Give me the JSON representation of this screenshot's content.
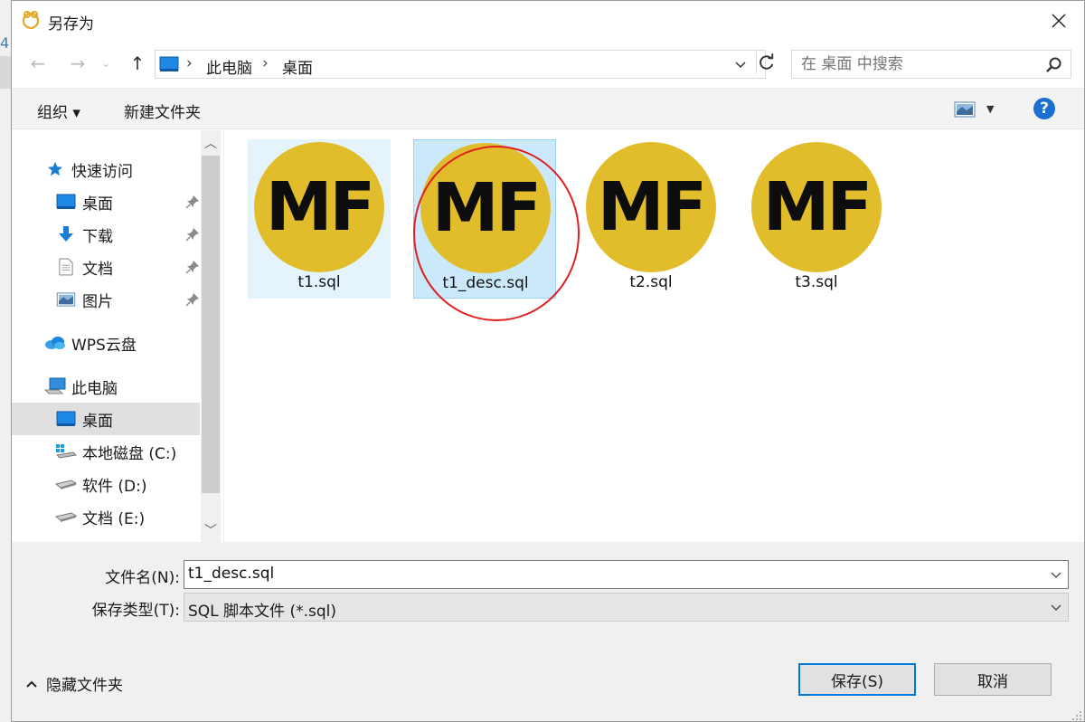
{
  "background": {
    "edge_number": "4"
  },
  "window": {
    "title": "另存为",
    "icon": "app-bee-icon"
  },
  "address": {
    "crumbs": [
      "此电脑",
      "桌面"
    ],
    "search_placeholder": "在 桌面 中搜索"
  },
  "toolbar": {
    "organize": "组织 ▾",
    "new_folder": "新建文件夹",
    "help": "?"
  },
  "sidebar": {
    "items": [
      {
        "label": "快速访问",
        "icon": "star-icon",
        "pinned": false
      },
      {
        "label": "桌面",
        "icon": "desktop-icon",
        "pinned": true
      },
      {
        "label": "下载",
        "icon": "download-icon",
        "pinned": true
      },
      {
        "label": "文档",
        "icon": "document-icon",
        "pinned": true
      },
      {
        "label": "图片",
        "icon": "pictures-icon",
        "pinned": true
      },
      {
        "label": "WPS云盘",
        "icon": "cloud-icon",
        "pinned": false
      },
      {
        "label": "此电脑",
        "icon": "computer-icon",
        "pinned": false
      },
      {
        "label": "桌面",
        "icon": "desktop-icon",
        "pinned": false,
        "selected": true
      },
      {
        "label": "本地磁盘 (C:)",
        "icon": "windows-drive-icon",
        "pinned": false
      },
      {
        "label": "软件 (D:)",
        "icon": "drive-icon",
        "pinned": false
      },
      {
        "label": "文档 (E:)",
        "icon": "drive-icon",
        "pinned": false
      }
    ]
  },
  "files": [
    {
      "name": "t1.sql",
      "logo_text": "MF",
      "state": "hover"
    },
    {
      "name": "t1_desc.sql",
      "logo_text": "MF",
      "state": "selected"
    },
    {
      "name": "t2.sql",
      "logo_text": "MF",
      "state": "normal"
    },
    {
      "name": "t3.sql",
      "logo_text": "MF",
      "state": "normal"
    }
  ],
  "form": {
    "filename_label": "文件名(N):",
    "filename_value": "t1_desc.sql",
    "type_label": "保存类型(T):",
    "type_value": "SQL 脚本文件 (*.sql)"
  },
  "footer": {
    "hide_folders": "隐藏文件夹",
    "save": "保存(S)",
    "cancel": "取消"
  },
  "colors": {
    "logo": "#e1bd2c",
    "selection": "#cce8fb",
    "accent": "#0078d7",
    "annotation": "#e02020"
  }
}
